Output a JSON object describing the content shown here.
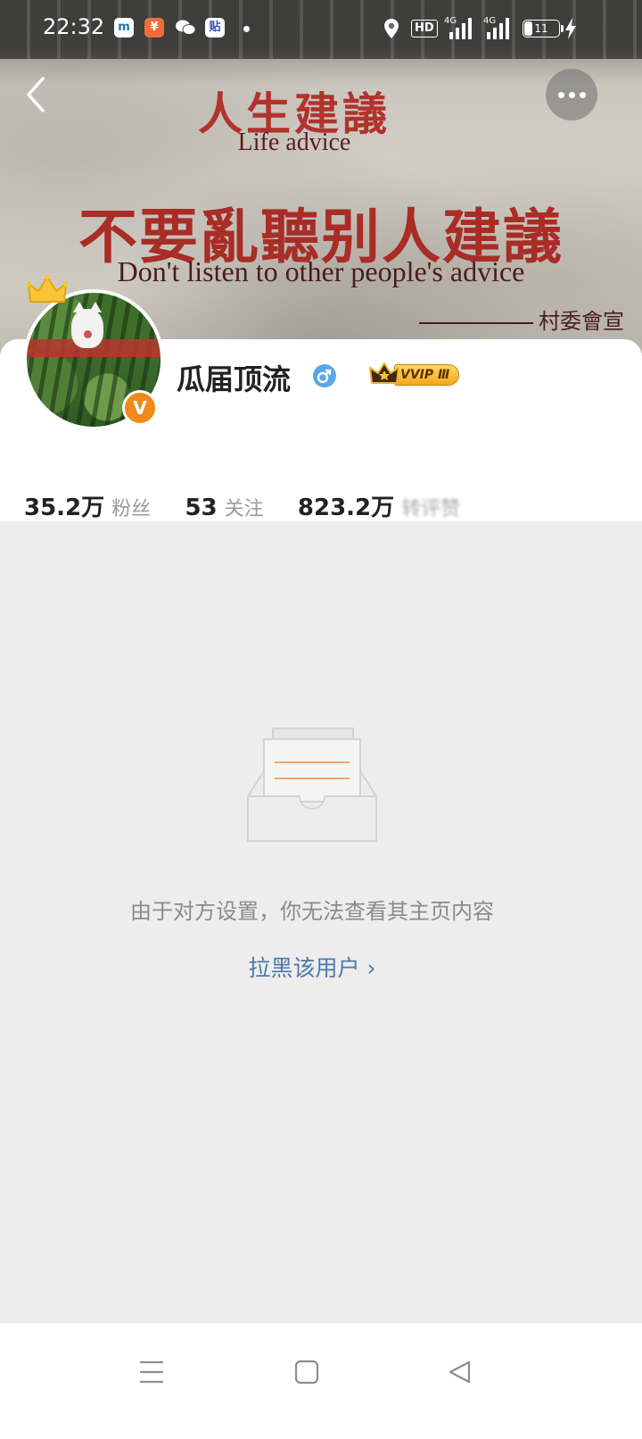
{
  "status_bar": {
    "time": "22:32",
    "apps": [
      {
        "name": "app-shield-icon",
        "glyph": "m",
        "bg": "#ffffff",
        "fg": "#1b6fb4"
      },
      {
        "name": "app-yuan-icon",
        "glyph": "¥",
        "bg": "#f26b3a",
        "fg": "#ffffff"
      },
      {
        "name": "wechat-icon",
        "glyph": "",
        "bg": "transparent",
        "fg": "#ffffff"
      },
      {
        "name": "tieba-icon",
        "glyph": "贴",
        "bg": "#ffffff",
        "fg": "#3a4fb8"
      }
    ],
    "hd_label": "HD",
    "network_1": "4G",
    "network_2": "4G",
    "battery_level": "11"
  },
  "banner": {
    "headline_cn": "人生建議",
    "headline_en": "Life advice",
    "main_cn": "不要亂聽别人建議",
    "main_en": "Don't listen to other people's advice",
    "signature": "村委會宣"
  },
  "profile": {
    "username": "瓜届顶流",
    "gender_symbol": "♂",
    "vip_label": "VVIP Ⅲ",
    "verified_badge": "V",
    "stats": [
      {
        "value": "35.2万",
        "label": "粉丝"
      },
      {
        "value": "53",
        "label": "关注"
      },
      {
        "value": "823.2万",
        "label": "转评赞"
      }
    ]
  },
  "empty_state": {
    "message": "由于对方设置，你无法查看其主页内容",
    "block_link": "拉黑该用户 ›"
  },
  "colors": {
    "accent_link": "#4e78a8",
    "badge_orange": "#f08a1b",
    "gender_blue": "#5aa7e6",
    "vip_gold": "#f2a91e"
  }
}
